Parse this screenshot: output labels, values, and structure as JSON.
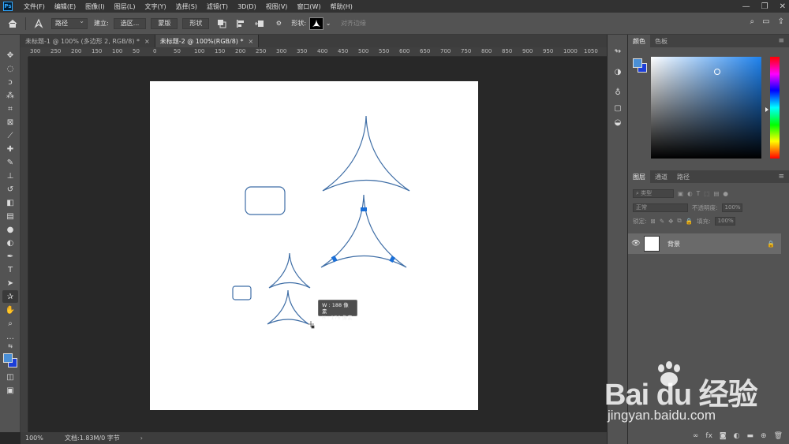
{
  "app": {
    "logo": "Ps"
  },
  "menu": [
    "文件(F)",
    "编辑(E)",
    "图像(I)",
    "图层(L)",
    "文字(Y)",
    "选择(S)",
    "滤镜(T)",
    "3D(D)",
    "视图(V)",
    "窗口(W)",
    "帮助(H)"
  ],
  "window_controls": [
    "minimize-icon",
    "restore-icon",
    "close-icon"
  ],
  "options": {
    "mode_value": "路径",
    "build_label": "建立:",
    "selection_btn": "选区...",
    "mask_btn": "蒙版",
    "shape_btn": "形状",
    "shape_label": "形状:",
    "align_edges": "对齐边缘"
  },
  "tabs": [
    {
      "label": "未标题-1 @ 100% (多边形 2, RGB/8) *",
      "close": "×",
      "active": false
    },
    {
      "label": "未标题-2 @ 100%(RGB/8) *",
      "close": "×",
      "active": true
    }
  ],
  "ruler_ticks": [
    "300",
    "250",
    "200",
    "150",
    "100",
    "50",
    "0",
    "50",
    "100",
    "150",
    "200",
    "250",
    "300",
    "350",
    "400",
    "450",
    "500",
    "550",
    "600",
    "650",
    "700",
    "750",
    "800",
    "850",
    "900",
    "950",
    "1000",
    "1050"
  ],
  "tooltip": {
    "w": "W : 188 像素",
    "h": "H : 176 像素"
  },
  "status": {
    "zoom": "100%",
    "doc": "文档:1.83M/0 字节",
    "arrow": "›"
  },
  "color_panel": {
    "tabs": [
      "颜色",
      "色板"
    ],
    "foreground": "#4a8fd6",
    "background": "#1c3ed8"
  },
  "layers_panel": {
    "tabs": [
      "图层",
      "通道",
      "路径"
    ],
    "filter_label": "类型",
    "blend_mode": "正常",
    "opacity_label": "不透明度:",
    "opacity_value": "100%",
    "lock_label": "锁定:",
    "fill_label": "填充:",
    "fill_value": "100%",
    "layer_name": "背景"
  },
  "watermark": {
    "logo": "Bai du 经验",
    "url": "jingyan.baidu.com"
  },
  "colors": {
    "path_stroke": "#3f6ea6",
    "anchor": "#1a6fd8"
  }
}
